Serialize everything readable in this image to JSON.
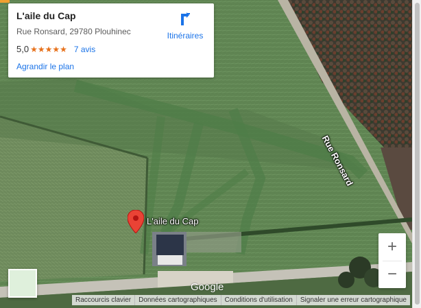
{
  "info_card": {
    "title": "L'aile du Cap",
    "address": "Rue Ronsard, 29780 Plouhinec",
    "rating": "5,0",
    "stars": "★★★★★",
    "reviews": "7 avis",
    "enlarge_link": "Agrandir le plan",
    "directions_label": "Itinéraires"
  },
  "map": {
    "road_label": "Rue Ronsard",
    "marker_label": "L'aile du Cap",
    "google_logo": "Google",
    "marker_color": "#ea4335"
  },
  "zoom": {
    "in_label": "+",
    "out_label": "−"
  },
  "footer": {
    "shortcuts": "Raccourcis clavier",
    "map_data": "Données cartographiques",
    "terms": "Conditions d'utilisation",
    "report": "Signaler une erreur cartographique"
  }
}
